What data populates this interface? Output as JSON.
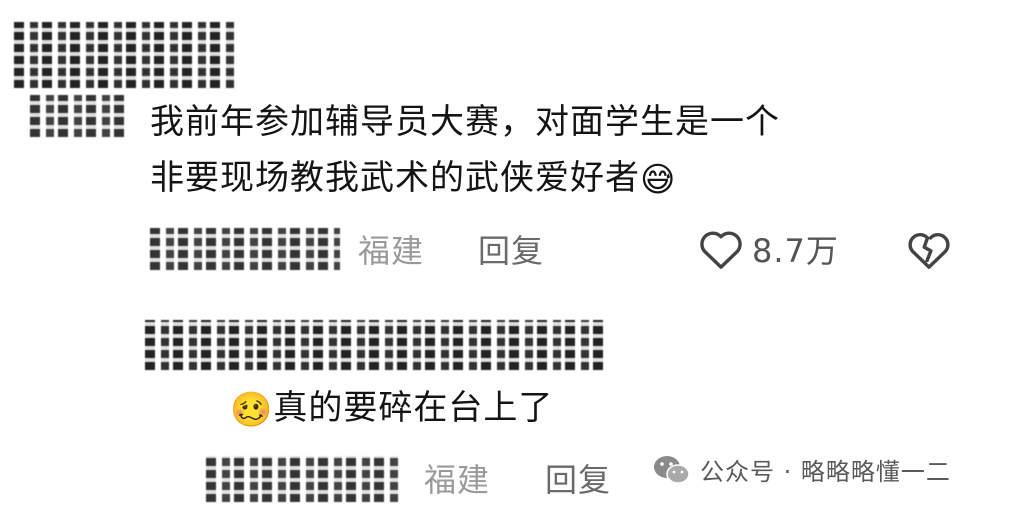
{
  "comment1": {
    "text_line1": "我前年参加辅导员大赛，对面学生是一个",
    "text_line2": "非要现场教我武术的武侠爱好者",
    "emoji": "😅",
    "location": "福建",
    "reply_label": "回复",
    "like_count": "8.7万"
  },
  "comment2": {
    "emoji": "🥴",
    "text": "真的要碎在台上了",
    "location": "福建",
    "reply_label": "回复"
  },
  "watermark": {
    "text": "公众号 · 略略略懂一二"
  },
  "icons": {
    "like": "heart-outline-icon",
    "dislike": "broken-heart-icon",
    "wechat": "wechat-icon"
  }
}
